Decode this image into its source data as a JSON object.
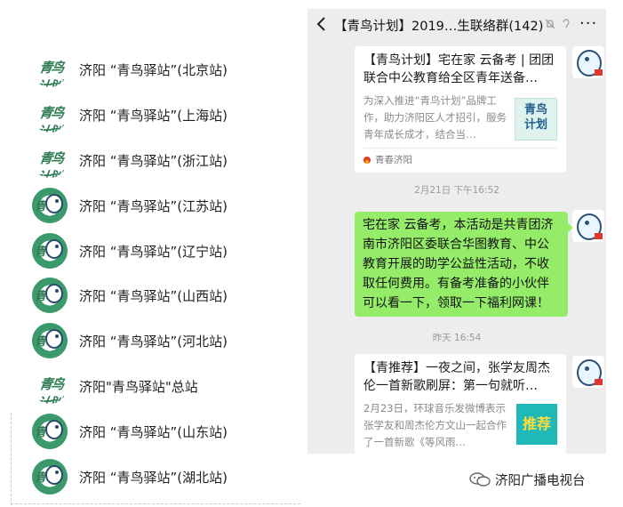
{
  "groups": [
    {
      "name": "济阳 “青鸟驿站”(北京站)",
      "avatar": "logo"
    },
    {
      "name": "济阳 “青鸟驿站”(上海站)",
      "avatar": "logo"
    },
    {
      "name": "济阳 “青鸟驿站”(浙江站)",
      "avatar": "logo"
    },
    {
      "name": "济阳 “青鸟驿站”(江苏站)",
      "avatar": "bird"
    },
    {
      "name": "济阳 “青鸟驿站”(辽宁站)",
      "avatar": "bird"
    },
    {
      "name": "济阳 “青鸟驿站”(山西站)",
      "avatar": "bird"
    },
    {
      "name": "济阳 “青鸟驿站”(河北站)",
      "avatar": "bird"
    },
    {
      "name": "济阳\"青鸟驿站\"总站",
      "avatar": "logo"
    },
    {
      "name": "济阳 “青鸟驿站”(山东站)",
      "avatar": "bird"
    },
    {
      "name": "济阳 “青鸟驿站”(湖北站)",
      "avatar": "bird"
    }
  ],
  "avatar_logo_text": "青鸟计划",
  "avatar_bird_text": "青鸟",
  "chat": {
    "title": "【青鸟计划】2019…生联络群(142)",
    "messages": {
      "card1": {
        "title": "【青鸟计划】宅在家 云备考 | 团团联合中公教育给全区青年送备…",
        "desc": "为深入推进“青鸟计划”品牌工作，助力济阳区人才招引，服务青年成长成才，结合当…",
        "thumb_text": "青鸟计划",
        "source": "青春济阳"
      },
      "time1": "2月21日 下午16:52",
      "text1": "宅在家 云备考，本活动是共青团济南市济阳区委联合华图教育、中公教育开展的助学公益性活动，不收取任何费用。有备考准备的小伙伴可以看一下，领取一下福利网课！",
      "time2": "昨天 16:54",
      "card2": {
        "title": "【青推荐】一夜之间，张学友周杰伦一首新歌刷屏：第一句就听…",
        "desc": "2月23日，环球音乐发微博表示张学友和周杰伦方文山一起合作了一首新歌《等风雨…",
        "thumb_text": "推荐"
      }
    }
  },
  "watermark": "济阳广播电视台",
  "colors": {
    "chat_bg": "#ededed",
    "bubble_green": "#95ec69",
    "brand_green": "#2f7d54"
  }
}
